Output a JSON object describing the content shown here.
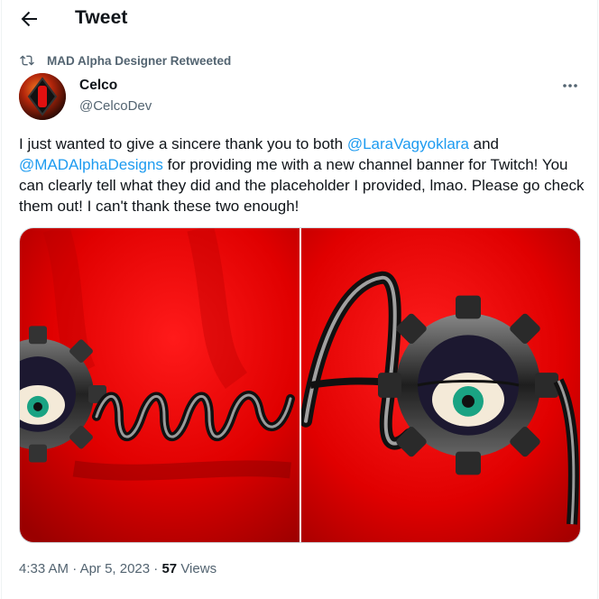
{
  "header": {
    "title": "Tweet"
  },
  "retweet": {
    "label": "MAD Alpha Designer Retweeted"
  },
  "author": {
    "name": "Celco",
    "handle": "@CelcoDev"
  },
  "tweet": {
    "text_1": "I just wanted to give a sincere thank you to both ",
    "mention_1": "@LaraVagyoklara",
    "text_2": " and ",
    "mention_2": "@MADAlphaDesigns",
    "text_3": " for providing me with a new channel banner for Twitch! You can clearly tell what they did and the placeholder I provided, lmao. Please go check them out! I can't thank these two enough!"
  },
  "meta": {
    "time": "4:33 AM",
    "sep1": " · ",
    "date": "Apr 5, 2023",
    "sep2": " · ",
    "views_count": "57",
    "views_label": " Views"
  },
  "colors": {
    "accent": "#1d9bf0",
    "muted": "#536471",
    "text": "#0f1419",
    "banner_red": "#e60000"
  },
  "icons": [
    "back-arrow-icon",
    "retweet-icon",
    "more-icon"
  ]
}
